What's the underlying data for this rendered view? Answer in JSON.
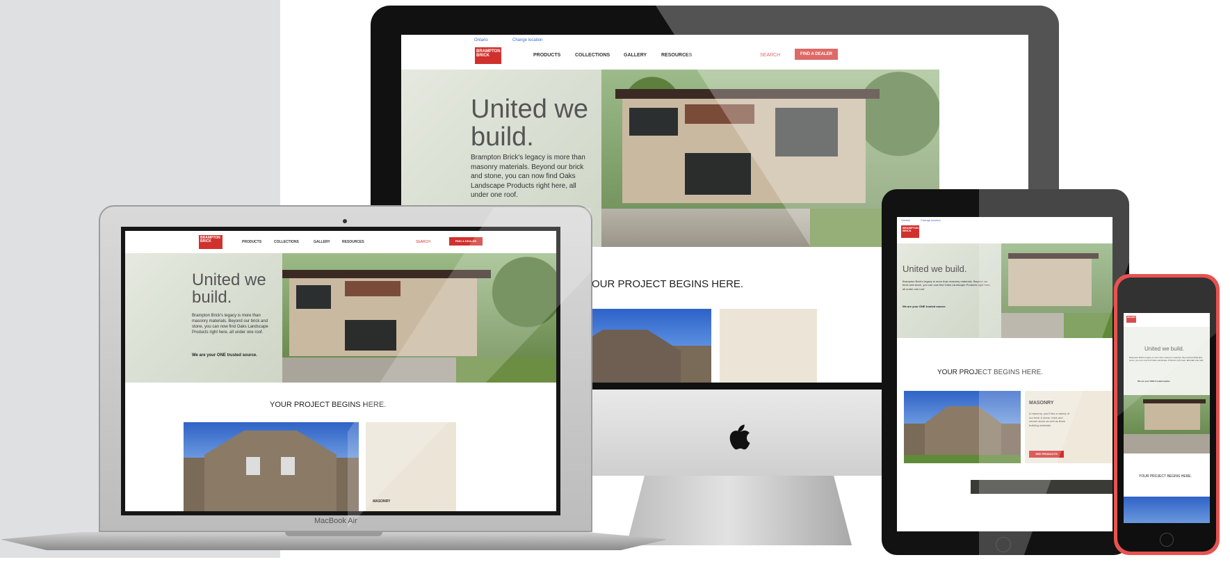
{
  "site": {
    "logo_line1": "BRAMPTON",
    "logo_line2": "BRICK",
    "nav": [
      "PRODUCTS",
      "COLLECTIONS",
      "GALLERY",
      "RESOURCES"
    ],
    "search_label": "SEARCH",
    "cta_label": "FIND A DEALER",
    "topbar_left": "Ontario",
    "topbar_right": "Change location",
    "hero_title_line1": "United we",
    "hero_title_line2": "build.",
    "hero_body": "Brampton Brick's legacy is more than masonry materials. Beyond our brick and stone, you can now find Oaks Landscape Products right here, all under one roof.",
    "hero_strong": "We are your ONE trusted source.",
    "section_title": "YOUR PROJECT BEGINS HERE.",
    "masonry_label": "MASONRY",
    "masonry_body": "A masonry, you'll find a variety of our brick & stone, brick and veneer stone as well as Brick building materials.",
    "masonry_button": "SEE PRODUCTS",
    "phone_title": "United we build.",
    "phone_section": "YOUR PROJECT BEGINS HERE."
  },
  "devices": {
    "laptop_label": "MacBook Air"
  },
  "colors": {
    "brand_red": "#d0312d",
    "left_panel": "#dfe0e2"
  }
}
